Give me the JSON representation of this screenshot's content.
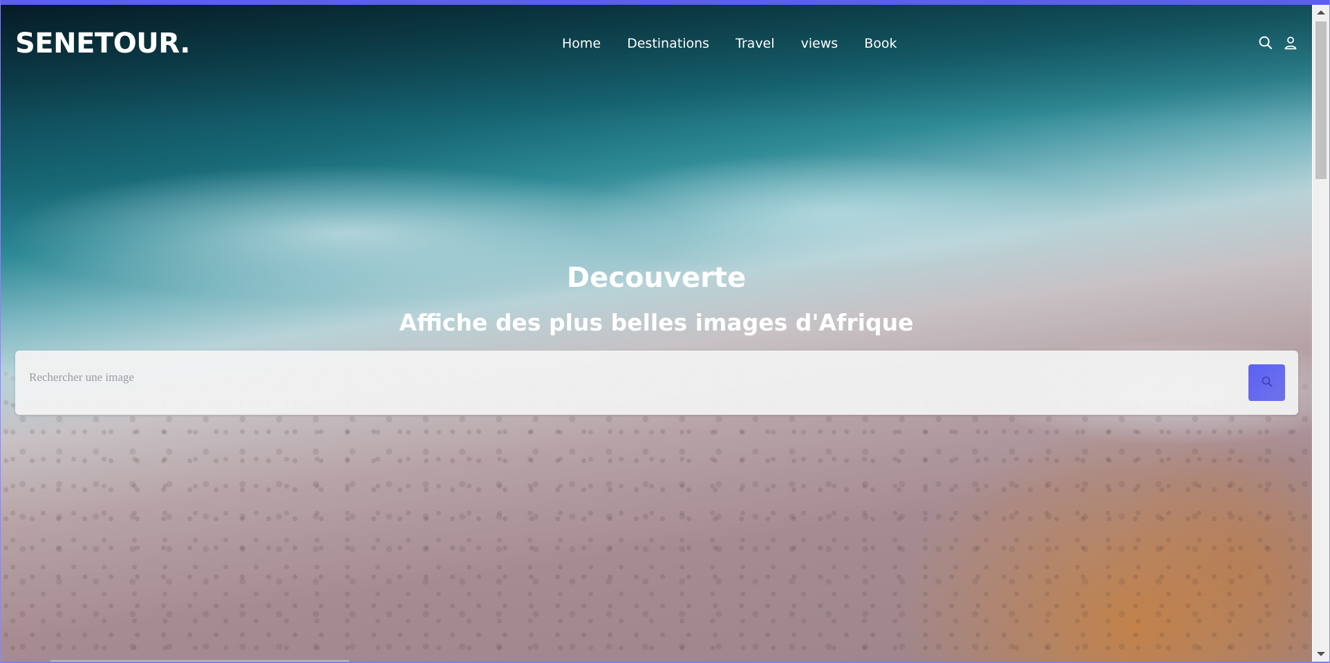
{
  "brand": {
    "name": "SENETOUR."
  },
  "nav": {
    "items": [
      {
        "label": "Home"
      },
      {
        "label": "Destinations"
      },
      {
        "label": "Travel"
      },
      {
        "label": "views"
      },
      {
        "label": "Book"
      }
    ],
    "icons": [
      "search-icon",
      "user-icon"
    ]
  },
  "hero": {
    "title": "Decouverte",
    "subtitle": "Affiche des plus belles images d'Afrique"
  },
  "search": {
    "placeholder": "Rechercher une image",
    "value": "",
    "button_icon": "search-icon"
  },
  "colors": {
    "accent": "#5b62f4",
    "window_border": "#5b5ef0",
    "text_on_hero": "#ffffff"
  }
}
